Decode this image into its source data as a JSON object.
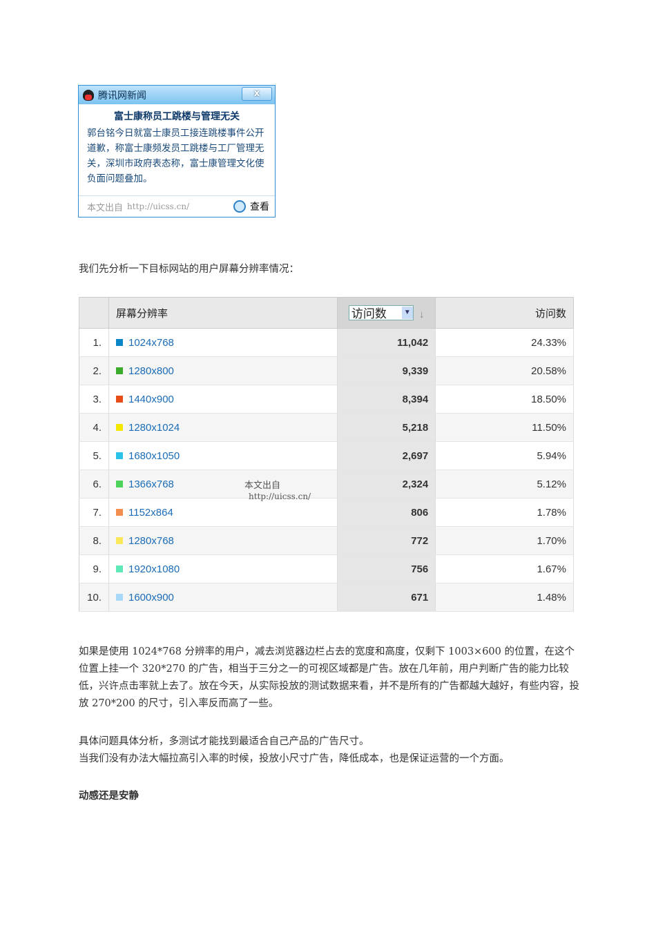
{
  "popup": {
    "app": "腾讯网新闻",
    "close": "x",
    "headline": "富士康称员工跳楼与管理无关",
    "body": "郭台铭今日就富士康员工接连跳楼事件公开道歉，称富士康频发员工跳楼与工厂管理无关，深圳市政府表态称，富士康管理文化使负面问题叠加。",
    "source_label": "本文出自",
    "source_url": "http://uicss.cn/",
    "view": "查看"
  },
  "intro": "我们先分析一下目标网站的用户屏幕分辨率情况：",
  "table": {
    "col_resolution": "屏幕分辨率",
    "metric_select": "访问数",
    "col_visits": "访问数",
    "watermark_label": "本文出自",
    "watermark_url": "http://uicss.cn/",
    "rows": [
      {
        "n": "1.",
        "res": "1024x768",
        "visits": "11,042",
        "pct": "24.33%",
        "color": "#0a86c8"
      },
      {
        "n": "2.",
        "res": "1280x800",
        "visits": "9,339",
        "pct": "20.58%",
        "color": "#3aab2a"
      },
      {
        "n": "3.",
        "res": "1440x900",
        "visits": "8,394",
        "pct": "18.50%",
        "color": "#e84d17"
      },
      {
        "n": "4.",
        "res": "1280x1024",
        "visits": "5,218",
        "pct": "11.50%",
        "color": "#f2e800"
      },
      {
        "n": "5.",
        "res": "1680x1050",
        "visits": "2,697",
        "pct": "5.94%",
        "color": "#2bc3e8"
      },
      {
        "n": "6.",
        "res": "1366x768",
        "visits": "2,324",
        "pct": "5.12%",
        "color": "#4cd35a"
      },
      {
        "n": "7.",
        "res": "1152x864",
        "visits": "806",
        "pct": "1.78%",
        "color": "#f58f4f"
      },
      {
        "n": "8.",
        "res": "1280x768",
        "visits": "772",
        "pct": "1.70%",
        "color": "#f9e85a"
      },
      {
        "n": "9.",
        "res": "1920x1080",
        "visits": "756",
        "pct": "1.67%",
        "color": "#5ee8b8"
      },
      {
        "n": "10.",
        "res": "1600x900",
        "visits": "671",
        "pct": "1.48%",
        "color": "#a8d8f8"
      }
    ]
  },
  "para1": "如果是使用 1024*768 分辨率的用户，减去浏览器边栏占去的宽度和高度，仅剩下 1003×600 的位置，在这个位置上挂一个 320*270 的广告，相当于三分之一的可视区域都是广告。放在几年前，用户判断广告的能力比较低，兴许点击率就上去了。放在今天，从实际投放的测试数据来看，并不是所有的广告都越大越好，有些内容，投放 270*200 的尺寸，引入率反而高了一些。",
  "para2": "具体问题具体分析，多测试才能找到最适合自己产品的广告尺寸。",
  "para3": "当我们没有办法大幅拉高引入率的时候，投放小尺寸广告，降低成本，也是保证运营的一个方面。",
  "heading": "动感还是安静"
}
